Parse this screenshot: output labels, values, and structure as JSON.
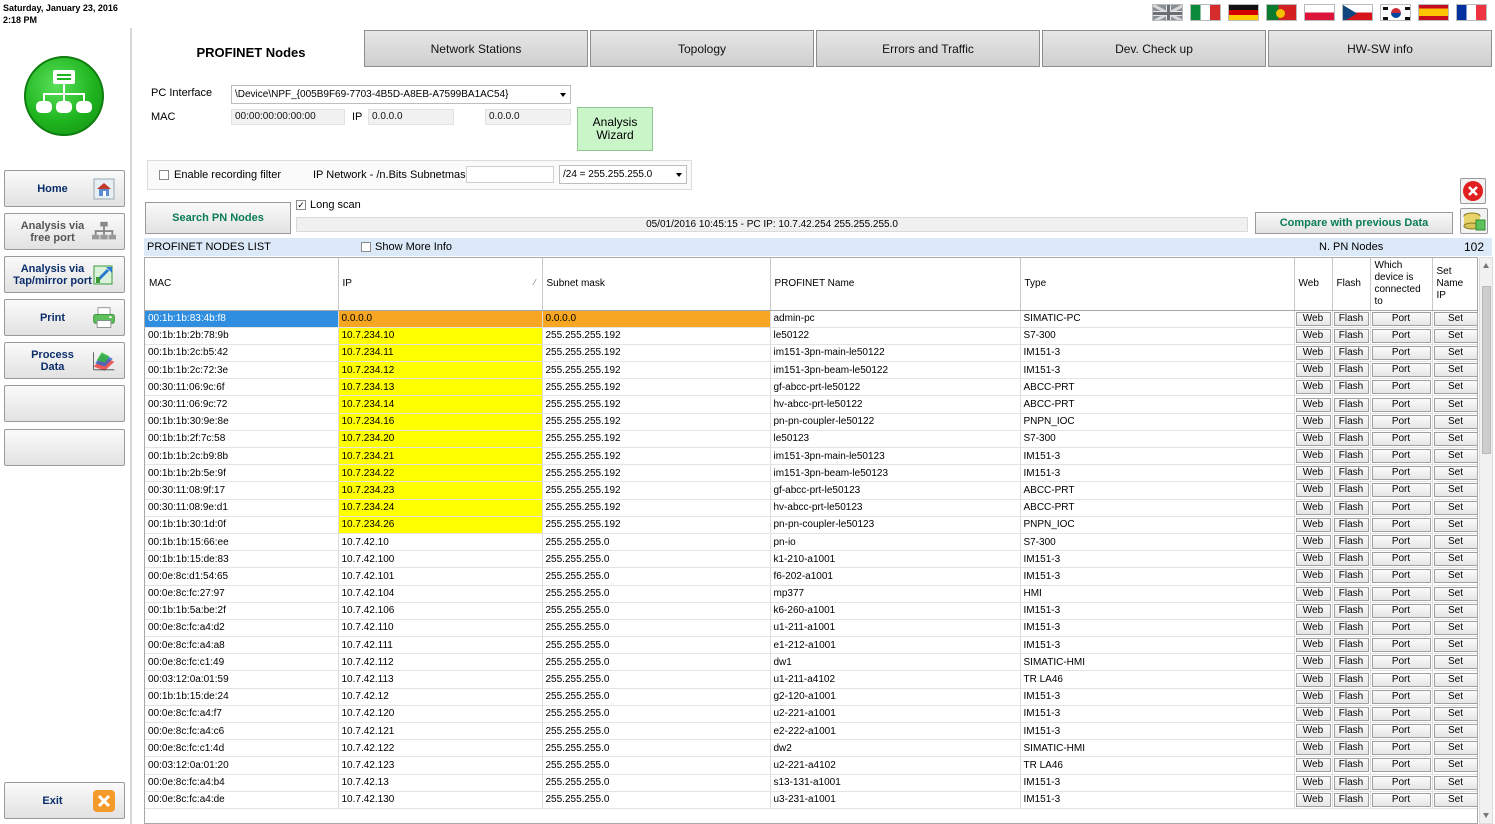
{
  "top": {
    "date": "Saturday, January 23, 2016",
    "time": "2:18 PM",
    "flags": [
      "uk-flag",
      "italy-flag",
      "germany-flag",
      "portugal-flag",
      "poland-flag",
      "czech-flag",
      "korea-flag",
      "spain-flag",
      "france-flag"
    ]
  },
  "sidebar": {
    "home": "Home",
    "analysis_free_1": "Analysis via",
    "analysis_free_2": "free port",
    "analysis_tap_1": "Analysis via",
    "analysis_tap_2": "Tap/mirror port",
    "print": "Print",
    "process_1": "Process",
    "process_2": "Data",
    "exit": "Exit"
  },
  "tabs": {
    "active": "PROFINET Nodes",
    "items": [
      "Network Stations",
      "Topology",
      "Errors and Traffic",
      "Dev. Check up",
      "HW-SW info"
    ]
  },
  "interface": {
    "pc_interface_label": "PC Interface",
    "pc_interface_value": "\\Device\\NPF_{005B9F69-7703-4B5D-A8EB-A7599BA1AC54}",
    "mac_label": "MAC",
    "mac_value": "00:00:00:00:00:00",
    "ip_label": "IP",
    "ip_value": "0.0.0.0",
    "ip_value2": "0.0.0.0",
    "wizard_1": "Analysis",
    "wizard_2": "Wizard"
  },
  "filter": {
    "enable_recording": "Enable recording filter",
    "ip_network_label": "IP Network - /n.Bits Subnetmask",
    "ip_network_value": "",
    "subnet_select": "/24 = 255.255.255.0",
    "long_scan": "Long scan",
    "long_scan_checked": "✓"
  },
  "actions": {
    "search": "Search PN Nodes",
    "status": "05/01/2016     10:45:15 - PC IP: 10.7.42.254   255.255.255.0",
    "compare": "Compare with previous Data"
  },
  "list": {
    "title": "PROFINET NODES LIST",
    "show_more": "Show More Info",
    "count_label": "N. PN Nodes",
    "count": "102"
  },
  "table": {
    "headers": {
      "mac": "MAC",
      "ip": "IP",
      "subnet": "Subnet mask",
      "name": "PROFINET Name",
      "type": "Type",
      "web": "Web",
      "flash": "Flash",
      "which_1": "Which",
      "which_2": "device is",
      "which_3": "connected",
      "which_4": "to",
      "set_1": "Set",
      "set_2": "Name",
      "set_3": "IP"
    },
    "buttons": {
      "web": "Web",
      "flash": "Flash",
      "port": "Port",
      "set": "Set"
    },
    "rows": [
      {
        "mac": "00:1b:1b:83:4b:f8",
        "ip": "0.0.0.0",
        "subnet": "0.0.0.0",
        "name": "admin-pc",
        "type": "SIMATIC-PC",
        "hl": "orange",
        "sel": true
      },
      {
        "mac": "00:1b:1b:2b:78:9b",
        "ip": "10.7.234.10",
        "subnet": "255.255.255.192",
        "name": "le50122",
        "type": "S7-300",
        "hl": "yellow"
      },
      {
        "mac": "00:1b:1b:2c:b5:42",
        "ip": "10.7.234.11",
        "subnet": "255.255.255.192",
        "name": "im151-3pn-main-le50122",
        "type": "IM151-3",
        "hl": "yellow"
      },
      {
        "mac": "00:1b:1b:2c:72:3e",
        "ip": "10.7.234.12",
        "subnet": "255.255.255.192",
        "name": "im151-3pn-beam-le50122",
        "type": "IM151-3",
        "hl": "yellow"
      },
      {
        "mac": "00:30:11:06:9c:6f",
        "ip": "10.7.234.13",
        "subnet": "255.255.255.192",
        "name": "gf-abcc-prt-le50122",
        "type": "ABCC-PRT",
        "hl": "yellow"
      },
      {
        "mac": "00:30:11:06:9c:72",
        "ip": "10.7.234.14",
        "subnet": "255.255.255.192",
        "name": "hv-abcc-prt-le50122",
        "type": "ABCC-PRT",
        "hl": "yellow"
      },
      {
        "mac": "00:1b:1b:30:9e:8e",
        "ip": "10.7.234.16",
        "subnet": "255.255.255.192",
        "name": "pn-pn-coupler-le50122",
        "type": "PNPN_IOC",
        "hl": "yellow"
      },
      {
        "mac": "00:1b:1b:2f:7c:58",
        "ip": "10.7.234.20",
        "subnet": "255.255.255.192",
        "name": "le50123",
        "type": "S7-300",
        "hl": "yellow"
      },
      {
        "mac": "00:1b:1b:2c:b9:8b",
        "ip": "10.7.234.21",
        "subnet": "255.255.255.192",
        "name": "im151-3pn-main-le50123",
        "type": "IM151-3",
        "hl": "yellow"
      },
      {
        "mac": "00:1b:1b:2b:5e:9f",
        "ip": "10.7.234.22",
        "subnet": "255.255.255.192",
        "name": "im151-3pn-beam-le50123",
        "type": "IM151-3",
        "hl": "yellow"
      },
      {
        "mac": "00:30:11:08:9f:17",
        "ip": "10.7.234.23",
        "subnet": "255.255.255.192",
        "name": "gf-abcc-prt-le50123",
        "type": "ABCC-PRT",
        "hl": "yellow"
      },
      {
        "mac": "00:30:11:08:9e:d1",
        "ip": "10.7.234.24",
        "subnet": "255.255.255.192",
        "name": "hv-abcc-prt-le50123",
        "type": "ABCC-PRT",
        "hl": "yellow"
      },
      {
        "mac": "00:1b:1b:30:1d:0f",
        "ip": "10.7.234.26",
        "subnet": "255.255.255.192",
        "name": "pn-pn-coupler-le50123",
        "type": "PNPN_IOC",
        "hl": "yellow"
      },
      {
        "mac": "00:1b:1b:15:66:ee",
        "ip": "10.7.42.10",
        "subnet": "255.255.255.0",
        "name": "pn-io",
        "type": "S7-300"
      },
      {
        "mac": "00:1b:1b:15:de:83",
        "ip": "10.7.42.100",
        "subnet": "255.255.255.0",
        "name": "k1-210-a1001",
        "type": "IM151-3"
      },
      {
        "mac": "00:0e:8c:d1:54:65",
        "ip": "10.7.42.101",
        "subnet": "255.255.255.0",
        "name": "f6-202-a1001",
        "type": "IM151-3"
      },
      {
        "mac": "00:0e:8c:fc:27:97",
        "ip": "10.7.42.104",
        "subnet": "255.255.255.0",
        "name": "mp377",
        "type": "HMI"
      },
      {
        "mac": "00:1b:1b:5a:be:2f",
        "ip": "10.7.42.106",
        "subnet": "255.255.255.0",
        "name": "k6-260-a1001",
        "type": "IM151-3"
      },
      {
        "mac": "00:0e:8c:fc:a4:d2",
        "ip": "10.7.42.110",
        "subnet": "255.255.255.0",
        "name": "u1-211-a1001",
        "type": "IM151-3"
      },
      {
        "mac": "00:0e:8c:fc:a4:a8",
        "ip": "10.7.42.111",
        "subnet": "255.255.255.0",
        "name": "e1-212-a1001",
        "type": "IM151-3"
      },
      {
        "mac": "00:0e:8c:fc:c1:49",
        "ip": "10.7.42.112",
        "subnet": "255.255.255.0",
        "name": "dw1",
        "type": "SIMATIC-HMI"
      },
      {
        "mac": "00:03:12:0a:01:59",
        "ip": "10.7.42.113",
        "subnet": "255.255.255.0",
        "name": "u1-211-a4102",
        "type": "TR LA46"
      },
      {
        "mac": "00:1b:1b:15:de:24",
        "ip": "10.7.42.12",
        "subnet": "255.255.255.0",
        "name": "g2-120-a1001",
        "type": "IM151-3"
      },
      {
        "mac": "00:0e:8c:fc:a4:f7",
        "ip": "10.7.42.120",
        "subnet": "255.255.255.0",
        "name": "u2-221-a1001",
        "type": "IM151-3"
      },
      {
        "mac": "00:0e:8c:fc:a4:c6",
        "ip": "10.7.42.121",
        "subnet": "255.255.255.0",
        "name": "e2-222-a1001",
        "type": "IM151-3"
      },
      {
        "mac": "00:0e:8c:fc:c1:4d",
        "ip": "10.7.42.122",
        "subnet": "255.255.255.0",
        "name": "dw2",
        "type": "SIMATIC-HMI"
      },
      {
        "mac": "00:03:12:0a:01:20",
        "ip": "10.7.42.123",
        "subnet": "255.255.255.0",
        "name": "u2-221-a4102",
        "type": "TR LA46"
      },
      {
        "mac": "00:0e:8c:fc:a4:b4",
        "ip": "10.7.42.13",
        "subnet": "255.255.255.0",
        "name": "s13-131-a1001",
        "type": "IM151-3"
      },
      {
        "mac": "00:0e:8c:fc:a4:de",
        "ip": "10.7.42.130",
        "subnet": "255.255.255.0",
        "name": "u3-231-a1001",
        "type": "IM151-3"
      }
    ]
  },
  "colors": {
    "orange_highlight": "#f6a622",
    "yellow_highlight": "#ffff00",
    "selected": "#2f8ee0",
    "green_text": "#0a7d53",
    "nav_text": "#0b2e6b"
  }
}
